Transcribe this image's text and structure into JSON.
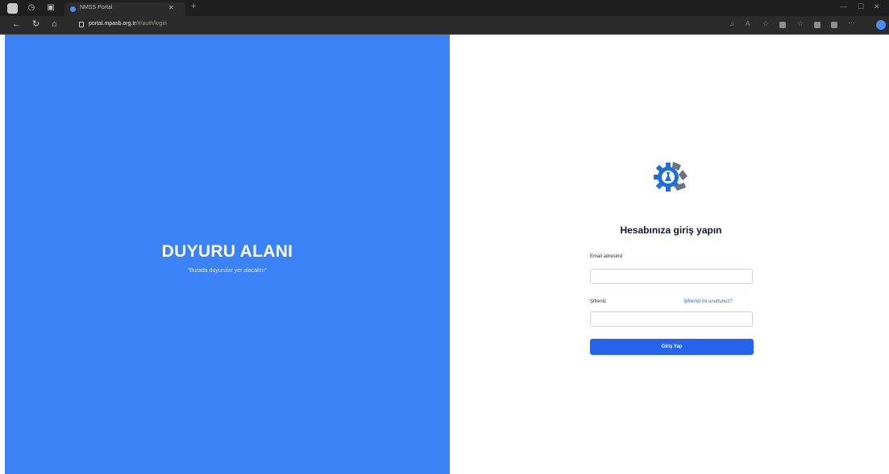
{
  "browser": {
    "tab_title": "NMSS Portal",
    "url_host": "portal.mpasb.org.tr",
    "url_path": "/#/auth/login"
  },
  "announcement": {
    "title": "DUYURU ALANI",
    "subtitle": "\"Burada duyurular yer alacaktır\""
  },
  "login": {
    "heading": "Hesabınıza giriş yapın",
    "email_label": "Email adresiniz",
    "email_value": "",
    "password_label": "Şifreniz",
    "password_value": "",
    "forgot_link": "Şifrenizi mi unuttunuz?",
    "submit_label": "Giriş Yap"
  },
  "colors": {
    "announcement_bg": "#3b82f6",
    "primary_button": "#2563eb",
    "logo_blue": "#1e6fd9",
    "logo_gray": "#6b7280"
  }
}
